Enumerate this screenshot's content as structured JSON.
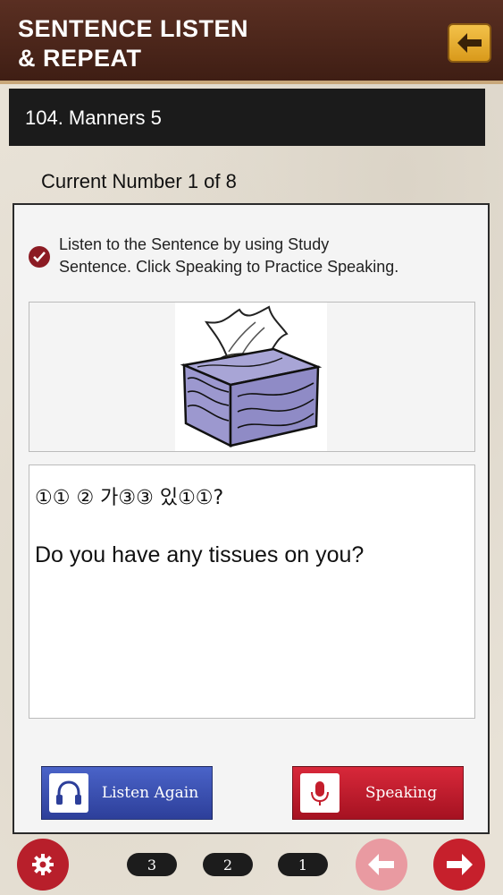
{
  "header": {
    "title_line1": "SENTENCE LISTEN",
    "title_line2": "& REPEAT",
    "back_icon": "arrow-left-icon"
  },
  "lesson": {
    "title": "104. Manners 5"
  },
  "counter": {
    "text": "Current Number 1 of 8"
  },
  "instruction": {
    "line1": "Listen to the Sentence by using Study",
    "line2": "Sentence. Click Speaking to Practice Speaking."
  },
  "sentence": {
    "korean": "①① ② 가③③ 있①①?",
    "english": "Do you have any tissues on you?"
  },
  "buttons": {
    "listen_label": "Listen Again",
    "speak_label": "Speaking"
  },
  "footer": {
    "pages": [
      "3",
      "2",
      "1"
    ]
  },
  "colors": {
    "header": "#4b2519",
    "accent_red": "#c6202c",
    "accent_blue": "#3a50b0",
    "back_button": "#e8ad2e"
  }
}
